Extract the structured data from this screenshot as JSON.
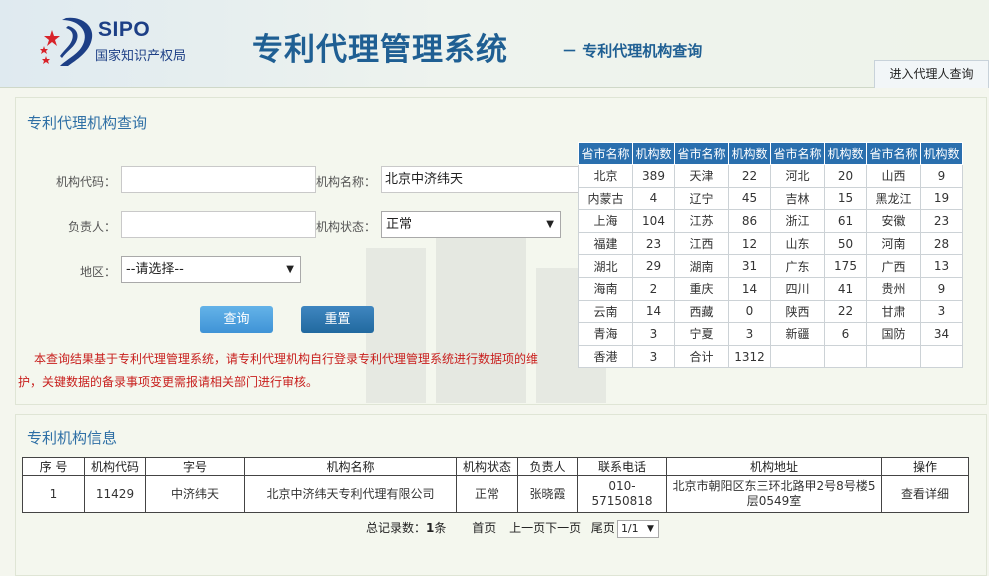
{
  "header": {
    "logo_sipo": "SIPO",
    "logo_cn": "国家知识产权局",
    "system_title": "专利代理管理系统",
    "subtitle": "－ 专利代理机构查询",
    "nav_tab": "进入代理人查询"
  },
  "query": {
    "title": "专利代理机构查询",
    "code_label": "机构代码：",
    "code_value": "",
    "name_label": "机构名称：",
    "name_value": "北京中济纬天",
    "person_label": "负责人：",
    "person_value": "",
    "status_label": "机构状态：",
    "status_value": "正常",
    "region_label": "地区：",
    "region_value": "--请选择--",
    "query_button": "查询",
    "reset_button": "重置",
    "notice": "本查询结果基于专利代理管理系统，请专利代理机构自行登录专利代理管理系统进行数据项的维护，关键数据的备录事项变更需报请相关部门进行审核。"
  },
  "stats": {
    "headers": [
      "省市名称",
      "机构数",
      "省市名称",
      "机构数",
      "省市名称",
      "机构数",
      "省市名称",
      "机构数"
    ],
    "rows": [
      [
        "北京",
        "389",
        "天津",
        "22",
        "河北",
        "20",
        "山西",
        "9"
      ],
      [
        "内蒙古",
        "4",
        "辽宁",
        "45",
        "吉林",
        "15",
        "黑龙江",
        "19"
      ],
      [
        "上海",
        "104",
        "江苏",
        "86",
        "浙江",
        "61",
        "安徽",
        "23"
      ],
      [
        "福建",
        "23",
        "江西",
        "12",
        "山东",
        "50",
        "河南",
        "28"
      ],
      [
        "湖北",
        "29",
        "湖南",
        "31",
        "广东",
        "175",
        "广西",
        "13"
      ],
      [
        "海南",
        "2",
        "重庆",
        "14",
        "四川",
        "41",
        "贵州",
        "9"
      ],
      [
        "云南",
        "14",
        "西藏",
        "0",
        "陕西",
        "22",
        "甘肃",
        "3"
      ],
      [
        "青海",
        "3",
        "宁夏",
        "3",
        "新疆",
        "6",
        "国防",
        "34"
      ],
      [
        "香港",
        "3",
        "合计",
        "1312",
        "",
        "",
        "",
        ""
      ]
    ]
  },
  "info": {
    "title": "专利机构信息",
    "headers": [
      "序 号",
      "机构代码",
      "字号",
      "机构名称",
      "机构状态",
      "负责人",
      "联系电话",
      "机构地址",
      "操作"
    ],
    "rows": [
      [
        "1",
        "11429",
        "中济纬天",
        "北京中济纬天专利代理有限公司",
        "正常",
        "张晓霞",
        "010-57150818",
        "北京市朝阳区东三环北路甲2号8号楼5层0549室",
        "查看详细"
      ]
    ],
    "pager": {
      "total_label": "总记录数：",
      "total_count": "1",
      "total_unit": "条",
      "first": "首页",
      "prev": "上一页",
      "next": "下一页",
      "last": "尾页",
      "page_select": "1/1"
    }
  },
  "colors": {
    "accent": "#2a6fae",
    "title_blue": "#1f5f93",
    "notice_red": "#c8201e"
  }
}
